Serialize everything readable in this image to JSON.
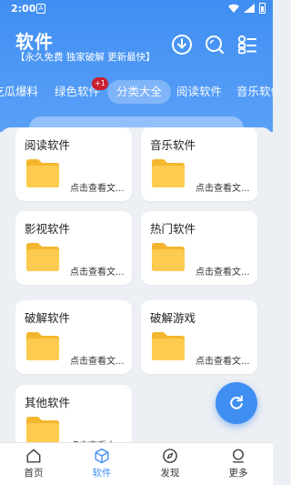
{
  "status_bar": {
    "time": "2:00",
    "app_badge": "A"
  },
  "header": {
    "title": "软件",
    "subtitle": "【永久免费 独家破解 更新最快】"
  },
  "tabs": [
    {
      "label": "吃瓜爆料"
    },
    {
      "label": "绿色软件",
      "badge": "+1"
    },
    {
      "label": "分类大全",
      "active": true
    },
    {
      "label": "阅读软件"
    },
    {
      "label": "音乐软件"
    }
  ],
  "cards": [
    {
      "title": "阅读软件",
      "sub": "点击查看文..."
    },
    {
      "title": "音乐软件",
      "sub": "点击查看文..."
    },
    {
      "title": "影视软件",
      "sub": "点击查看文..."
    },
    {
      "title": "热门软件",
      "sub": "点击查看文..."
    },
    {
      "title": "破解软件",
      "sub": "点击查看文..."
    },
    {
      "title": "破解游戏",
      "sub": "点击查看文..."
    },
    {
      "title": "其他软件",
      "sub": "点击查看文..."
    }
  ],
  "bottom_nav": [
    {
      "label": "首页",
      "icon": "home-icon"
    },
    {
      "label": "软件",
      "icon": "cube-icon",
      "active": true
    },
    {
      "label": "发现",
      "icon": "compass-icon"
    },
    {
      "label": "更多",
      "icon": "user-icon"
    }
  ],
  "colors": {
    "accent": "#3F8EF2",
    "badge": "#C9202F",
    "folder": "#FDCB4F"
  }
}
